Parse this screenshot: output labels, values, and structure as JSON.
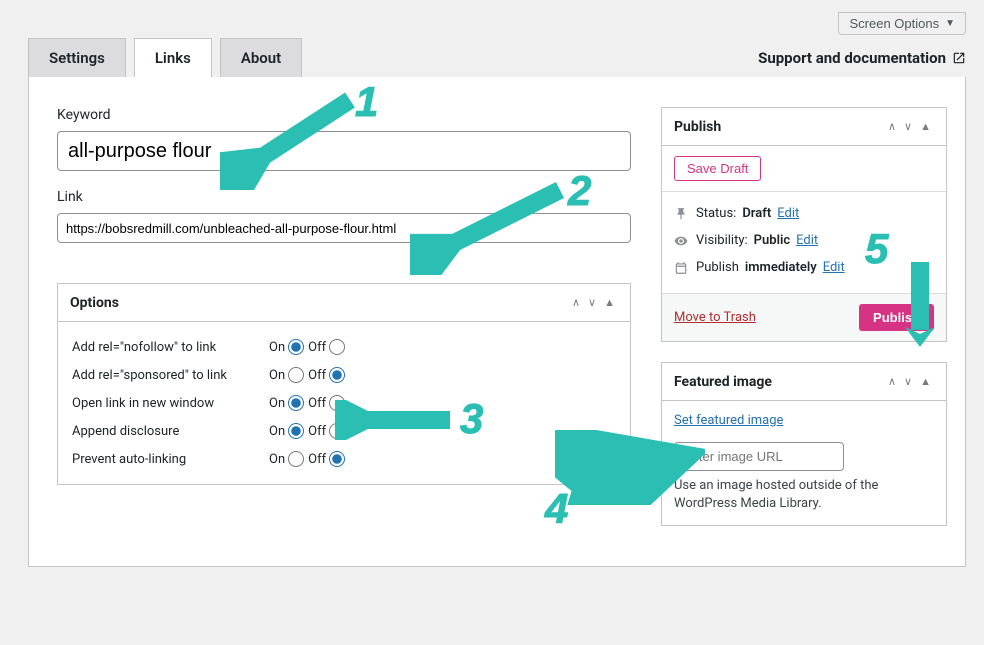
{
  "screen_options_label": "Screen Options",
  "tabs": {
    "settings": "Settings",
    "links": "Links",
    "about": "About"
  },
  "support_link": "Support and documentation",
  "fields": {
    "keyword_label": "Keyword",
    "keyword_value": "all-purpose flour",
    "link_label": "Link",
    "link_value": "https://bobsredmill.com/unbleached-all-purpose-flour.html"
  },
  "options_box": {
    "title": "Options",
    "on_label": "On",
    "off_label": "Off",
    "rows": [
      {
        "label": "Add rel=\"nofollow\" to link",
        "value": "on"
      },
      {
        "label": "Add rel=\"sponsored\" to link",
        "value": "off"
      },
      {
        "label": "Open link in new window",
        "value": "on"
      },
      {
        "label": "Append disclosure",
        "value": "on"
      },
      {
        "label": "Prevent auto-linking",
        "value": "off"
      }
    ]
  },
  "publish_box": {
    "title": "Publish",
    "save_draft": "Save Draft",
    "status_label": "Status:",
    "status_value": "Draft",
    "visibility_label": "Visibility:",
    "visibility_value": "Public",
    "schedule_label": "Publish",
    "schedule_value": "immediately",
    "edit_label": "Edit",
    "trash_link": "Move to Trash",
    "publish_btn": "Publish"
  },
  "featured_box": {
    "title": "Featured image",
    "set_link": "Set featured image",
    "url_placeholder": "Enter image URL",
    "description": "Use an image hosted outside of the WordPress Media Library."
  },
  "annotations": {
    "a1": "1",
    "a2": "2",
    "a3": "3",
    "a4": "4",
    "a5": "5"
  }
}
